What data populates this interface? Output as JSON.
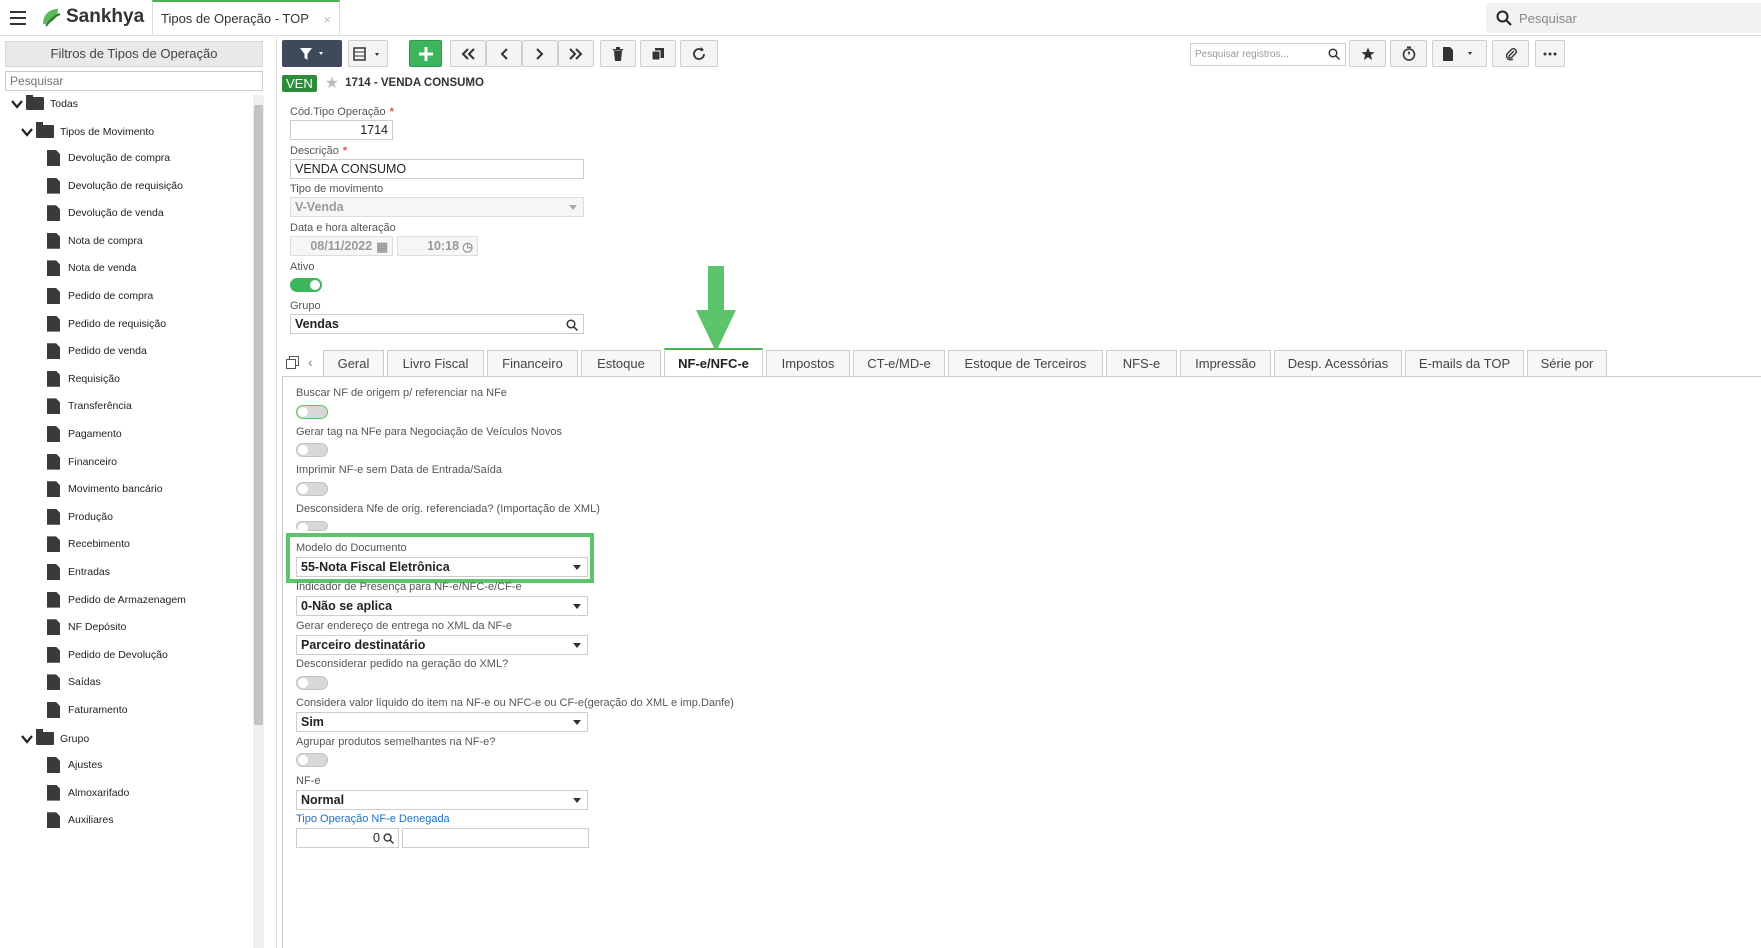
{
  "app": {
    "brand": "Sankhya",
    "tab_title": "Tipos de Operação - TOP",
    "tab_close": "×",
    "global_search_placeholder": "Pesquisar"
  },
  "left": {
    "filter_title": "Filtros de Tipos de Operação",
    "search_placeholder": "Pesquisar",
    "root": "Todas",
    "group_movimento": "Tipos de Movimento",
    "movimento_items": [
      "Devolução de compra",
      "Devolução de requisição",
      "Devolução de venda",
      "Nota de compra",
      "Nota de venda",
      "Pedido de compra",
      "Pedido de requisição",
      "Pedido de venda",
      "Requisição",
      "Transferência",
      "Pagamento",
      "Financeiro",
      "Movimento bancário",
      "Produção",
      "Recebimento",
      "Entradas",
      "Pedido de Armazenagem",
      "NF Depósito",
      "Pedido de Devolução",
      "Saídas",
      "Faturamento"
    ],
    "group_grupo": "Grupo",
    "grupo_items": [
      "Ajustes",
      "Almoxarifado",
      "Auxiliares"
    ]
  },
  "toolbar": {
    "search_placeholder": "Pesquisar registros..."
  },
  "record": {
    "badge": "VEN",
    "title": "1714 - VENDA CONSUMO"
  },
  "form": {
    "cod_label": "Cód.Tipo Operação",
    "cod_value": "1714",
    "required_mark": "*",
    "desc_label": "Descrição",
    "desc_value": "VENDA CONSUMO",
    "tipo_label": "Tipo de movimento",
    "tipo_value": "V-Venda",
    "data_label": "Data e hora alteração",
    "data_value": "08/11/2022",
    "hora_value": "10:18",
    "ativo_label": "Ativo",
    "grupo_label": "Grupo",
    "grupo_value": "Vendas"
  },
  "tabs": [
    "Geral",
    "Livro Fiscal",
    "Financeiro",
    "Estoque",
    "NF-e/NFC-e",
    "Impostos",
    "CT-e/MD-e",
    "Estoque de Terceiros",
    "NFS-e",
    "Impressão",
    "Desp. Acessórias",
    "E-mails da TOP",
    "Série por"
  ],
  "active_tab": "NF-e/NFC-e",
  "nfe": {
    "buscar_label": "Buscar NF de origem p/ referenciar na NFe",
    "gerar_tag_label": "Gerar tag na NFe para Negociação de Veículos Novos",
    "imprimir_label": "Imprimir NF-e sem Data de Entrada/Saída",
    "desconsidera_label": "Desconsidera Nfe de orig. referenciada? (Importação de XML)",
    "modelo_label": "Modelo do Documento",
    "modelo_value": "55-Nota Fiscal Eletrônica",
    "indicador_label": "Indicador de Presença para NF-e/NFC-e/CF-e",
    "indicador_value": "0-Não se aplica",
    "endereco_label": "Gerar endereço de entrega no XML da NF-e",
    "endereco_value": "Parceiro destinatário",
    "desconsiderar_pedido_label": "Desconsiderar pedido na geração do XML?",
    "considera_label": "Considera valor líquido do item na NF-e ou NFC-e ou CF-e(geração do XML e imp.Danfe)",
    "considera_value": "Sim",
    "agrupar_label": "Agrupar produtos semelhantes na NF-e?",
    "nfe_label": "NF-e",
    "nfe_value": "Normal",
    "denegada_label": "Tipo Operação NF-e Denegada",
    "denegada_value": "0"
  },
  "colors": {
    "accent": "#4caf50",
    "highlight": "#5cc46a",
    "badge": "#2e8b3a",
    "link": "#1a73c9"
  }
}
